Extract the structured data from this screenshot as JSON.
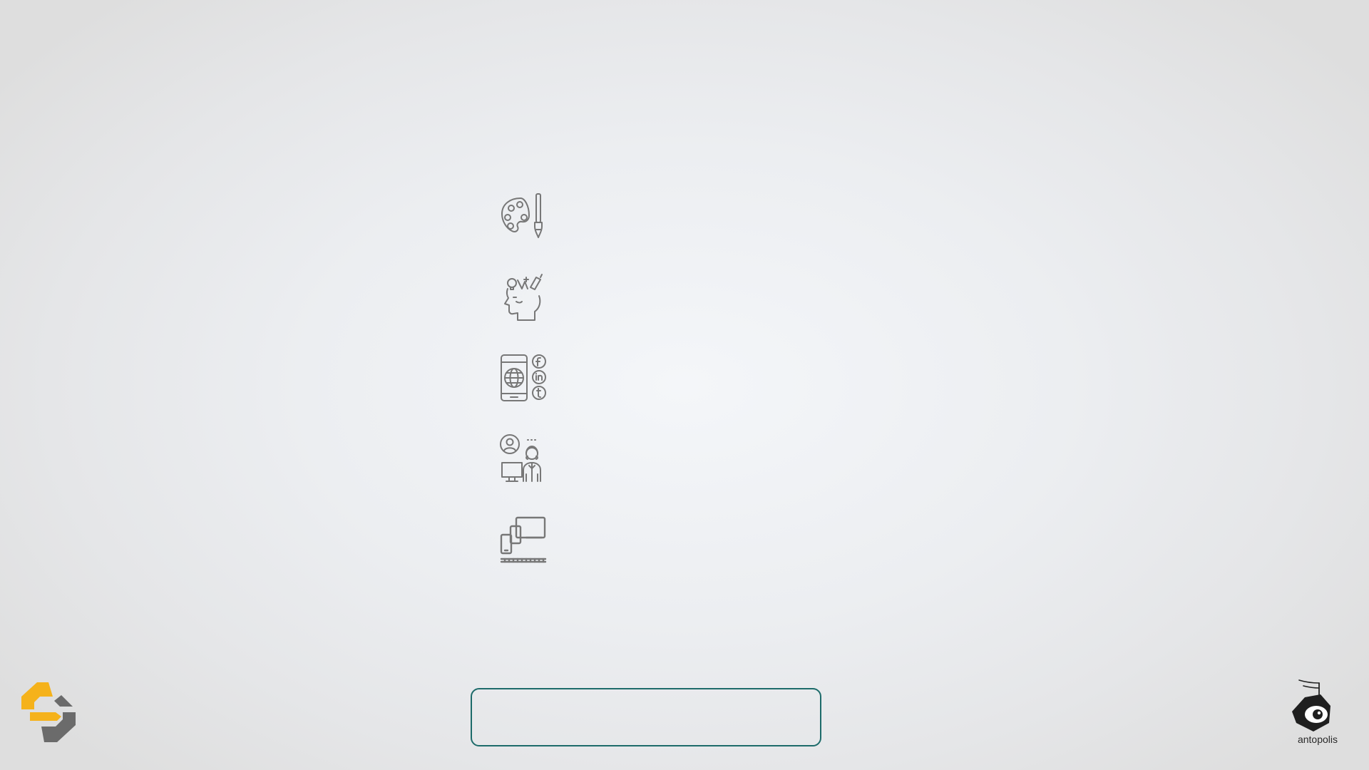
{
  "features": [
    {
      "icon": "palette-brush-icon"
    },
    {
      "icon": "creative-mind-icon"
    },
    {
      "icon": "mobile-social-media-icon"
    },
    {
      "icon": "developer-team-icon"
    },
    {
      "icon": "responsive-devices-icon"
    }
  ],
  "cta": {
    "label": ""
  },
  "branding": {
    "left_logo": "hexagon-s-logo",
    "right_logo": "antopolis-logo",
    "right_logo_text": "antopolis"
  },
  "colors": {
    "accent": "#1d6b6a",
    "logo_yellow": "#f5b21b",
    "logo_gray": "#6b6b6b",
    "icon_stroke": "#777777"
  }
}
